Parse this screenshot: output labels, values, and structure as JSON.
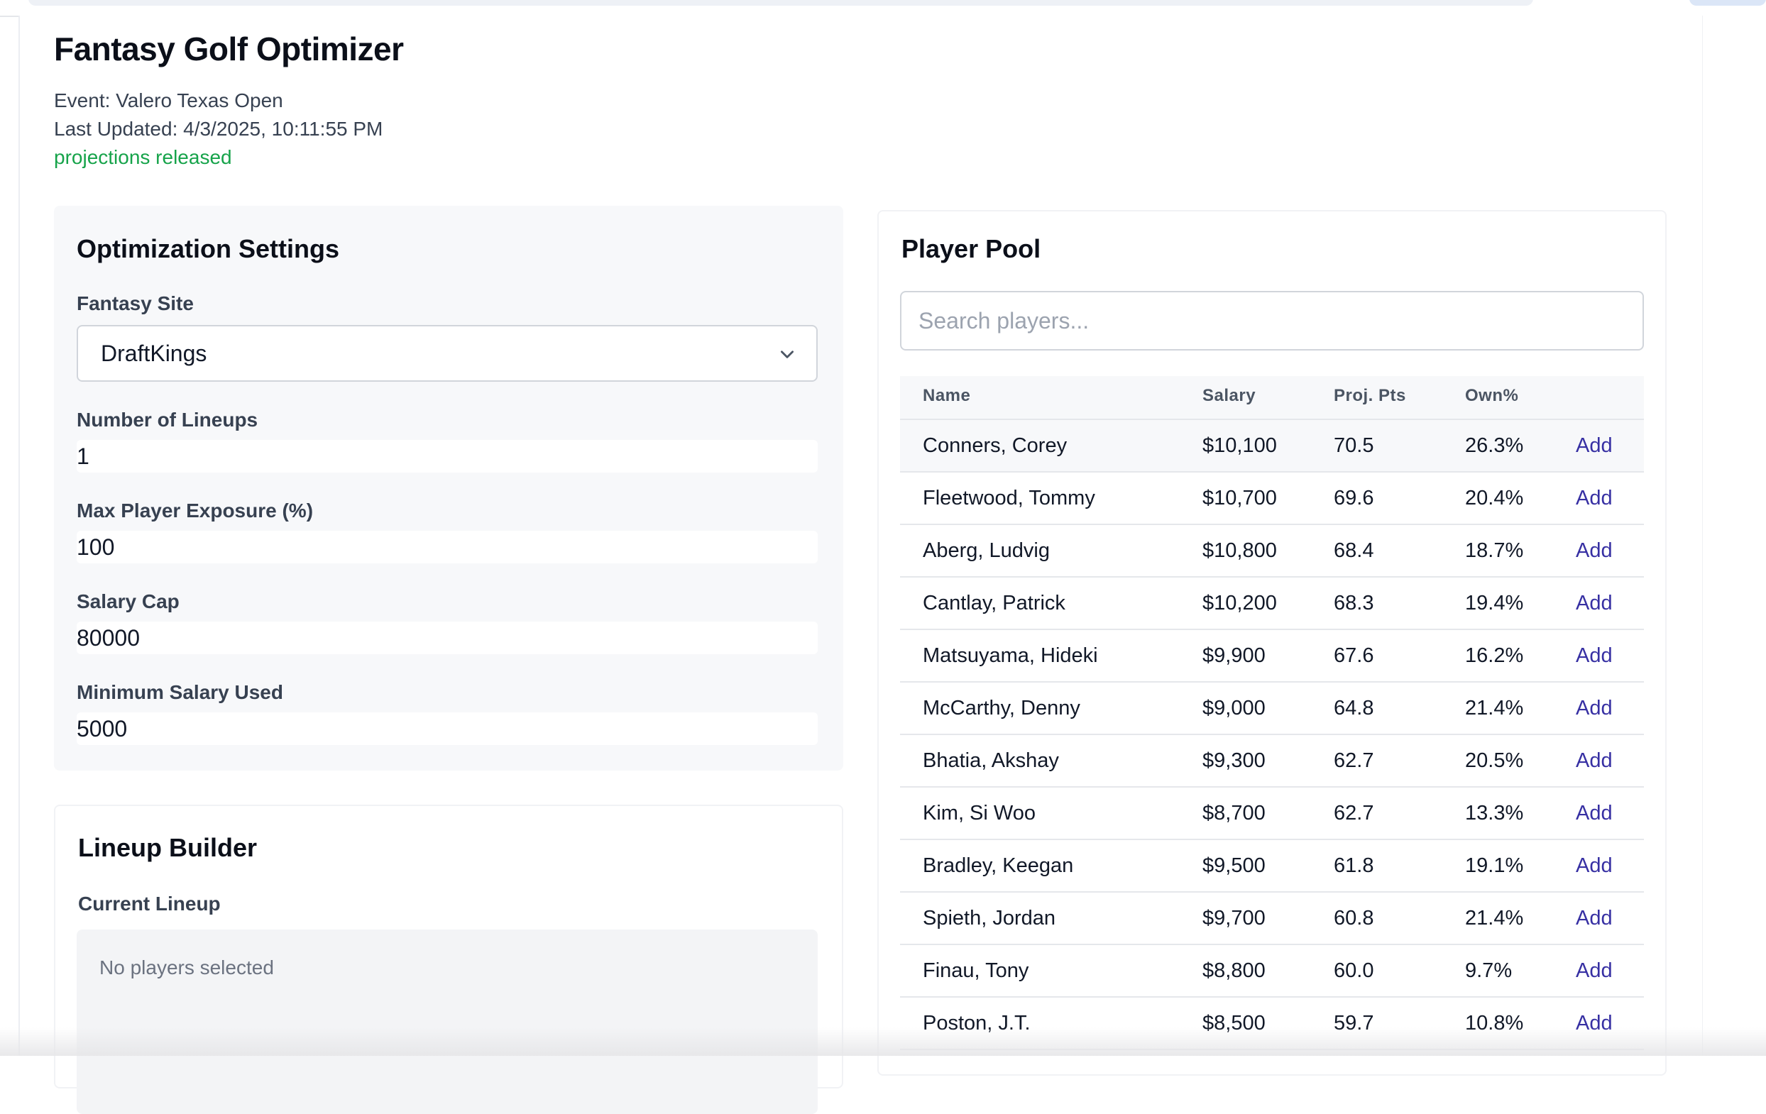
{
  "app": {
    "title": "Fantasy Golf Optimizer",
    "event": "Event: Valero Texas Open",
    "last_updated": "Last Updated: 4/3/2025, 10:11:55 PM",
    "status": "projections released",
    "status_color": "#16a34a"
  },
  "settings": {
    "title": "Optimization Settings",
    "site_label": "Fantasy Site",
    "site_value": "DraftKings",
    "lineups_label": "Number of Lineups",
    "lineups_value": "1",
    "exposure_label": "Max Player Exposure (%)",
    "exposure_value": "100",
    "salary_cap_label": "Salary Cap",
    "salary_cap_value": "80000",
    "min_salary_label": "Minimum Salary Used",
    "min_salary_value": "5000"
  },
  "builder": {
    "title": "Lineup Builder",
    "current_label": "Current Lineup",
    "empty_text": "No players selected"
  },
  "pool": {
    "title": "Player Pool",
    "search_placeholder": "Search players...",
    "columns": [
      "Name",
      "Salary",
      "Proj. Pts",
      "Own%"
    ],
    "add_label": "Add",
    "add_color": "#3730a3",
    "players": [
      {
        "name": "Conners, Corey",
        "salary": "$10,100",
        "proj": "70.5",
        "own": "26.3%"
      },
      {
        "name": "Fleetwood, Tommy",
        "salary": "$10,700",
        "proj": "69.6",
        "own": "20.4%"
      },
      {
        "name": "Aberg, Ludvig",
        "salary": "$10,800",
        "proj": "68.4",
        "own": "18.7%"
      },
      {
        "name": "Cantlay, Patrick",
        "salary": "$10,200",
        "proj": "68.3",
        "own": "19.4%"
      },
      {
        "name": "Matsuyama, Hideki",
        "salary": "$9,900",
        "proj": "67.6",
        "own": "16.2%"
      },
      {
        "name": "McCarthy, Denny",
        "salary": "$9,000",
        "proj": "64.8",
        "own": "21.4%"
      },
      {
        "name": "Bhatia, Akshay",
        "salary": "$9,300",
        "proj": "62.7",
        "own": "20.5%"
      },
      {
        "name": "Kim, Si Woo",
        "salary": "$8,700",
        "proj": "62.7",
        "own": "13.3%"
      },
      {
        "name": "Bradley, Keegan",
        "salary": "$9,500",
        "proj": "61.8",
        "own": "19.1%"
      },
      {
        "name": "Spieth, Jordan",
        "salary": "$9,700",
        "proj": "60.8",
        "own": "21.4%"
      },
      {
        "name": "Finau, Tony",
        "salary": "$8,800",
        "proj": "60.0",
        "own": "9.7%"
      },
      {
        "name": "Poston, J.T.",
        "salary": "$8,500",
        "proj": "59.7",
        "own": "10.8%"
      }
    ]
  }
}
